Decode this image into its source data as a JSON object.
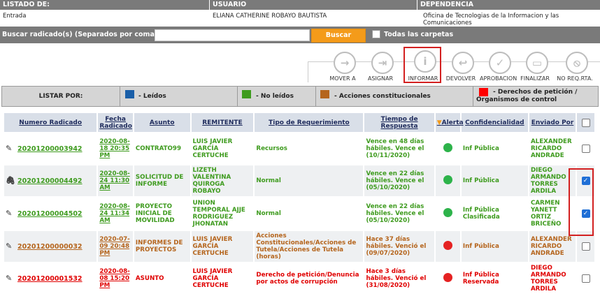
{
  "header": {
    "listado_label": "LISTADO DE:",
    "listado_value": "Entrada",
    "usuario_label": "USUARIO",
    "usuario_value": "ELIANA CATHERINE ROBAYO BAUTISTA",
    "dependencia_label": "DEPENDENCIA",
    "dependencia_value": "Oficina de Tecnologias de la Informacion y las Comunicaciones"
  },
  "search": {
    "label": "Buscar radicado(s) (Separados por coma)",
    "value": "",
    "button": "Buscar",
    "all_folders": "Todas las carpetas"
  },
  "toolbar": [
    {
      "label": "MOVER A",
      "icon": "arrow-right-icon",
      "glyph": "→"
    },
    {
      "label": "ASIGNAR",
      "icon": "assign-icon",
      "glyph": "⇥"
    },
    {
      "label": "INFORMAR",
      "icon": "info-icon",
      "glyph": "i"
    },
    {
      "label": "DEVOLVER",
      "icon": "return-icon",
      "glyph": "↩"
    },
    {
      "label": "APROBACION",
      "icon": "check-icon",
      "glyph": "✓"
    },
    {
      "label": "FINALIZAR",
      "icon": "finalize-icon",
      "glyph": "▭"
    },
    {
      "label": "NO REQ.RTA.",
      "icon": "no-reply-icon",
      "glyph": "⦸"
    }
  ],
  "legend": {
    "title": "LISTAR POR:",
    "items": [
      {
        "label": "- Leídos",
        "color": "#1a5fa8"
      },
      {
        "label": "- No leídos",
        "color": "#3e9b1e"
      },
      {
        "label": "- Acciones constitucionales",
        "color": "#b5651d"
      },
      {
        "label": "- Derechos de petición / Organismos de control",
        "color": "#ff0000"
      }
    ]
  },
  "columns": [
    "Numero Radicado",
    "Fecha Radicado",
    "Asunto",
    "REMITENTE",
    "Tipo de Requerimiento",
    "Tiempo de Respuesta",
    "Alerta",
    "Confidencialidad",
    "Enviado Por"
  ],
  "rows": [
    {
      "radicado": "20201200003942",
      "fecha": "2020-08-18 20:35 PM",
      "asunto": "CONTRATO99",
      "remitente": "LUIS JAVIER GARCÍA CERTUCHE",
      "tipo": "Recursos",
      "tiempo": "Vence en 48 días hábiles. Vence el (10/11/2020)",
      "alerta": "#2db34a",
      "conf": "Inf Pública",
      "enviado": "ALEXANDER RICARDO ANDRADE",
      "color": "#3e9b1e",
      "checked": false,
      "icon": "edit-icon"
    },
    {
      "radicado": "20201200004492",
      "fecha": "2020-08-24 11:30 AM",
      "asunto": "SOLICITUD DE INFORME",
      "remitente": "LIZETH VALENTINA QUIROGA ROBAYO",
      "tipo": "Normal",
      "tiempo": "Vence en 22 días hábiles. Vence el (05/10/2020)",
      "alerta": "#2db34a",
      "conf": "Inf Pública",
      "enviado": "DIEGO ARMANDO TORRES ARDILA",
      "color": "#3e9b1e",
      "checked": true,
      "icon": "attachment-icon"
    },
    {
      "radicado": "20201200004502",
      "fecha": "2020-08-24 11:34 AM",
      "asunto": "PROYECTO INICIAL DE MOVILIDAD",
      "remitente": "UNION TEMPORAL AJJE RODRIGUEZ JHONATAN",
      "tipo": "Normal",
      "tiempo": "Vence en 22 días hábiles. Vence el (05/10/2020)",
      "alerta": "#2db34a",
      "conf": "Inf Pública Clasificada",
      "enviado": "CARMEN YANETT ORTIZ BRICEÑO",
      "color": "#3e9b1e",
      "checked": true,
      "icon": "edit-icon"
    },
    {
      "radicado": "20201200000032",
      "fecha": "2020-07-09 20:48 PM",
      "asunto": "INFORMES DE PROYECTOS",
      "remitente": "LUIS JAVIER GARCÍA CERTUCHE",
      "tipo": "Acciones Constitucionales/Acciones de Tutela/Acciones de Tutela (horas)",
      "tiempo": "Hace 37 días hábiles. Venció el (09/07/2020)",
      "alerta": "#e52222",
      "conf": "Inf Pública",
      "enviado": "ALEXANDER RICARDO ANDRADE",
      "color": "#b5651d",
      "checked": false,
      "icon": "edit-icon"
    },
    {
      "radicado": "20201200001532",
      "fecha": "2020-08-08 15:20 PM",
      "asunto": "ASUNTO",
      "remitente": "LUIS JAVIER GARCÍA CERTUCHE",
      "tipo": "Derecho de petición/Denuncia por actos de corrupción",
      "tiempo": "Hace 3 días hábiles. Venció el (31/08/2020)",
      "alerta": "#e52222",
      "conf": "Inf Pública Reservada",
      "enviado": "DIEGO ARMANDO TORRES ARDILA",
      "color": "#e00000",
      "checked": false,
      "icon": "edit-icon"
    }
  ]
}
